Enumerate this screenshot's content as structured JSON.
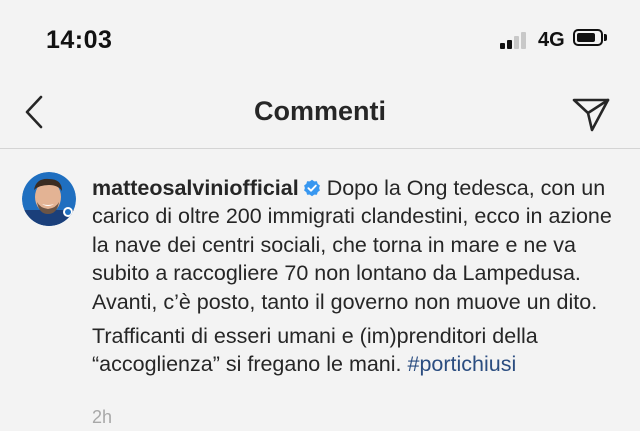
{
  "status_bar": {
    "time": "14:03",
    "network": "4G",
    "battery_level": 0.8,
    "signal_bars": 2
  },
  "header": {
    "title": "Commenti",
    "back_icon": "chevron-left-icon",
    "send_icon": "paper-plane-icon"
  },
  "comment": {
    "username": "matteosalviniofficial",
    "verified": true,
    "text_para1": "Dopo la Ong tedesca, con un carico di oltre 200 immigrati clandestini, ecco in azione la nave dei centri sociali, che torna in mare e ne va subito a raccogliere 70 non lontano da Lampedusa. Avanti, c’è posto, tanto il governo non muove un dito.",
    "text_para2": "Trafficanti di esseri umani e (im)prenditori della “accoglienza” si fregano le mani.",
    "hashtag": "#portichiusi",
    "timestamp": "2h"
  },
  "colors": {
    "background": "#f3f3f3",
    "text": "#262626",
    "hashtag": "#2b4d80",
    "verified_badge": "#3897f0",
    "muted": "#a8a8a8"
  }
}
